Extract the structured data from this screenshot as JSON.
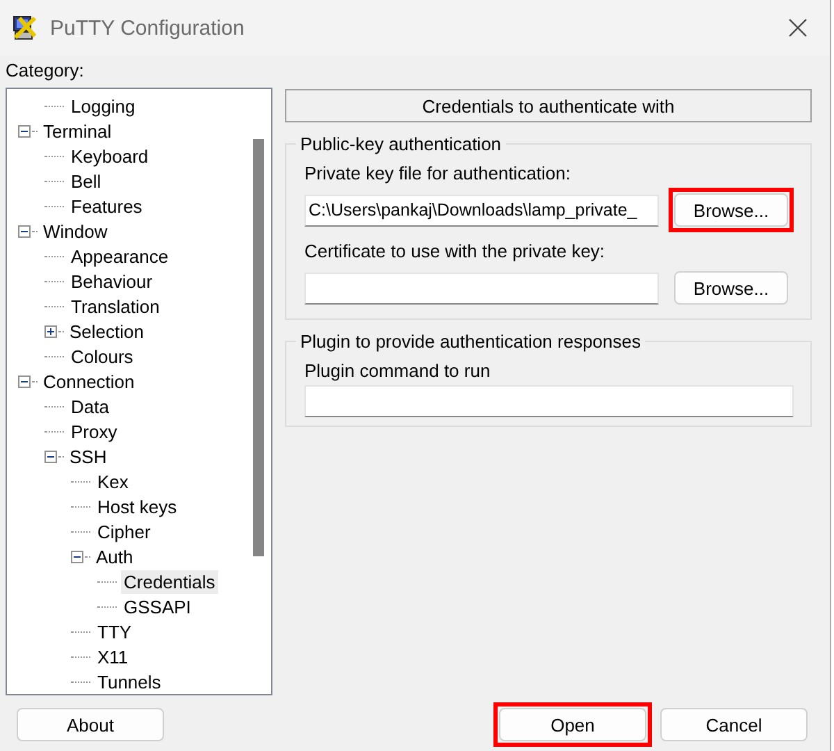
{
  "window": {
    "title": "PuTTY Configuration"
  },
  "category_label": "Category:",
  "tree": {
    "continued_items": [
      {
        "label": "Logging",
        "selected": false
      }
    ],
    "items": [
      {
        "label": "Terminal",
        "expanded": true,
        "selected": false,
        "children": [
          {
            "label": "Keyboard",
            "selected": false
          },
          {
            "label": "Bell",
            "selected": false
          },
          {
            "label": "Features",
            "selected": false
          }
        ]
      },
      {
        "label": "Window",
        "expanded": true,
        "selected": false,
        "children": [
          {
            "label": "Appearance",
            "selected": false
          },
          {
            "label": "Behaviour",
            "selected": false
          },
          {
            "label": "Translation",
            "selected": false
          },
          {
            "label": "Selection",
            "expanded": false,
            "selected": false
          },
          {
            "label": "Colours",
            "selected": false
          }
        ]
      },
      {
        "label": "Connection",
        "expanded": true,
        "selected": false,
        "children": [
          {
            "label": "Data",
            "selected": false
          },
          {
            "label": "Proxy",
            "selected": false
          },
          {
            "label": "SSH",
            "expanded": true,
            "selected": false,
            "children": [
              {
                "label": "Kex",
                "selected": false
              },
              {
                "label": "Host keys",
                "selected": false
              },
              {
                "label": "Cipher",
                "selected": false
              },
              {
                "label": "Auth",
                "expanded": true,
                "selected": false,
                "children": [
                  {
                    "label": "Credentials",
                    "selected": true
                  },
                  {
                    "label": "GSSAPI",
                    "selected": false
                  }
                ]
              },
              {
                "label": "TTY",
                "selected": false
              },
              {
                "label": "X11",
                "selected": false
              },
              {
                "label": "Tunnels",
                "selected": false
              }
            ]
          }
        ]
      }
    ]
  },
  "panel_title": "Credentials to authenticate with",
  "groups": [
    {
      "title": "Public-key authentication",
      "fields": [
        {
          "label": "Private key file for authentication:",
          "value": "C:\\Users\\pankaj\\Downloads\\lamp_private_",
          "button": {
            "label": "Browse...",
            "highlighted": true
          }
        },
        {
          "label": "Certificate to use with the private key:",
          "button": {
            "label": "Browse...",
            "highlighted": false
          }
        }
      ]
    },
    {
      "title": "Plugin to provide authentication responses",
      "fields": [
        {
          "label": "Plugin command to run"
        }
      ]
    }
  ],
  "buttons": [
    {
      "label": "About",
      "highlighted": false
    },
    {
      "label": "Open",
      "highlighted": true
    },
    {
      "label": "Cancel",
      "highlighted": false
    }
  ]
}
